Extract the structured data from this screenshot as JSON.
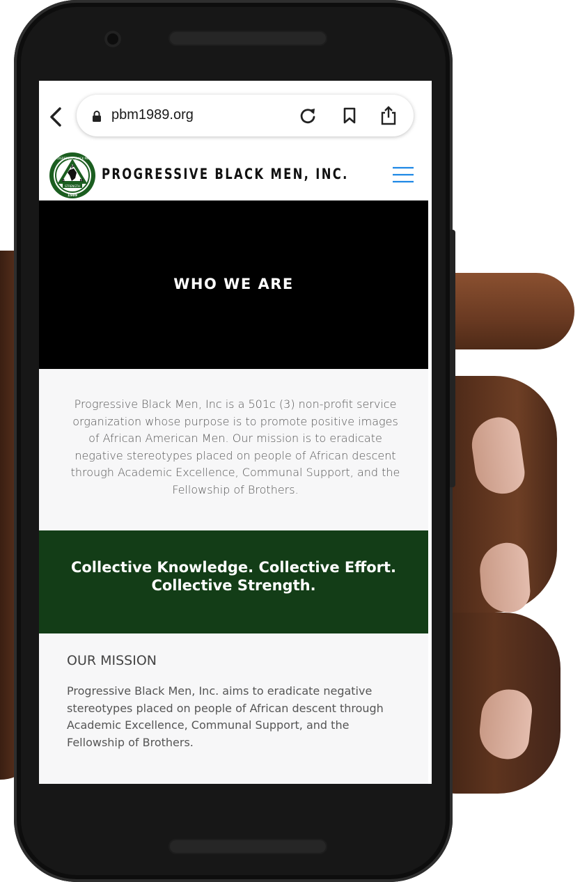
{
  "browser": {
    "url": "pbm1989.org",
    "icons": {
      "back": "chevron-left-icon",
      "lock": "lock-icon",
      "reload": "reload-icon",
      "bookmark": "bookmark-icon",
      "share": "share-icon"
    }
  },
  "header": {
    "brand": "PROGRESSIVE BLACK MEN, INC.",
    "logo": {
      "top_text": "PROGRESSIVE BLACK MEN",
      "ribbon_text": "STRENGTH",
      "year": "1989",
      "letters": [
        "P",
        "B",
        "M"
      ]
    },
    "menu_icon": "hamburger-icon",
    "accent_color": "#1e88e5"
  },
  "hero": {
    "title": "WHO WE ARE"
  },
  "intro": {
    "text": "Progressive Black Men, Inc is a 501c (3) non-profit service organization whose purpose is to promote positive images of African American Men. Our mission is to eradicate negative stereotypes placed on people of African descent through Academic Excellence, Communal Support, and the Fellowship of Brothers."
  },
  "banner": {
    "text": "Collective Knowledge. Collective Effort. Collective Strength.",
    "color": "#133d17"
  },
  "mission": {
    "title": "OUR MISSION",
    "text": "Progressive Black Men, Inc. aims to eradicate negative stereotypes placed on people of African descent through Academic Excellence, Communal Support, and the Fellowship of Brothers."
  }
}
